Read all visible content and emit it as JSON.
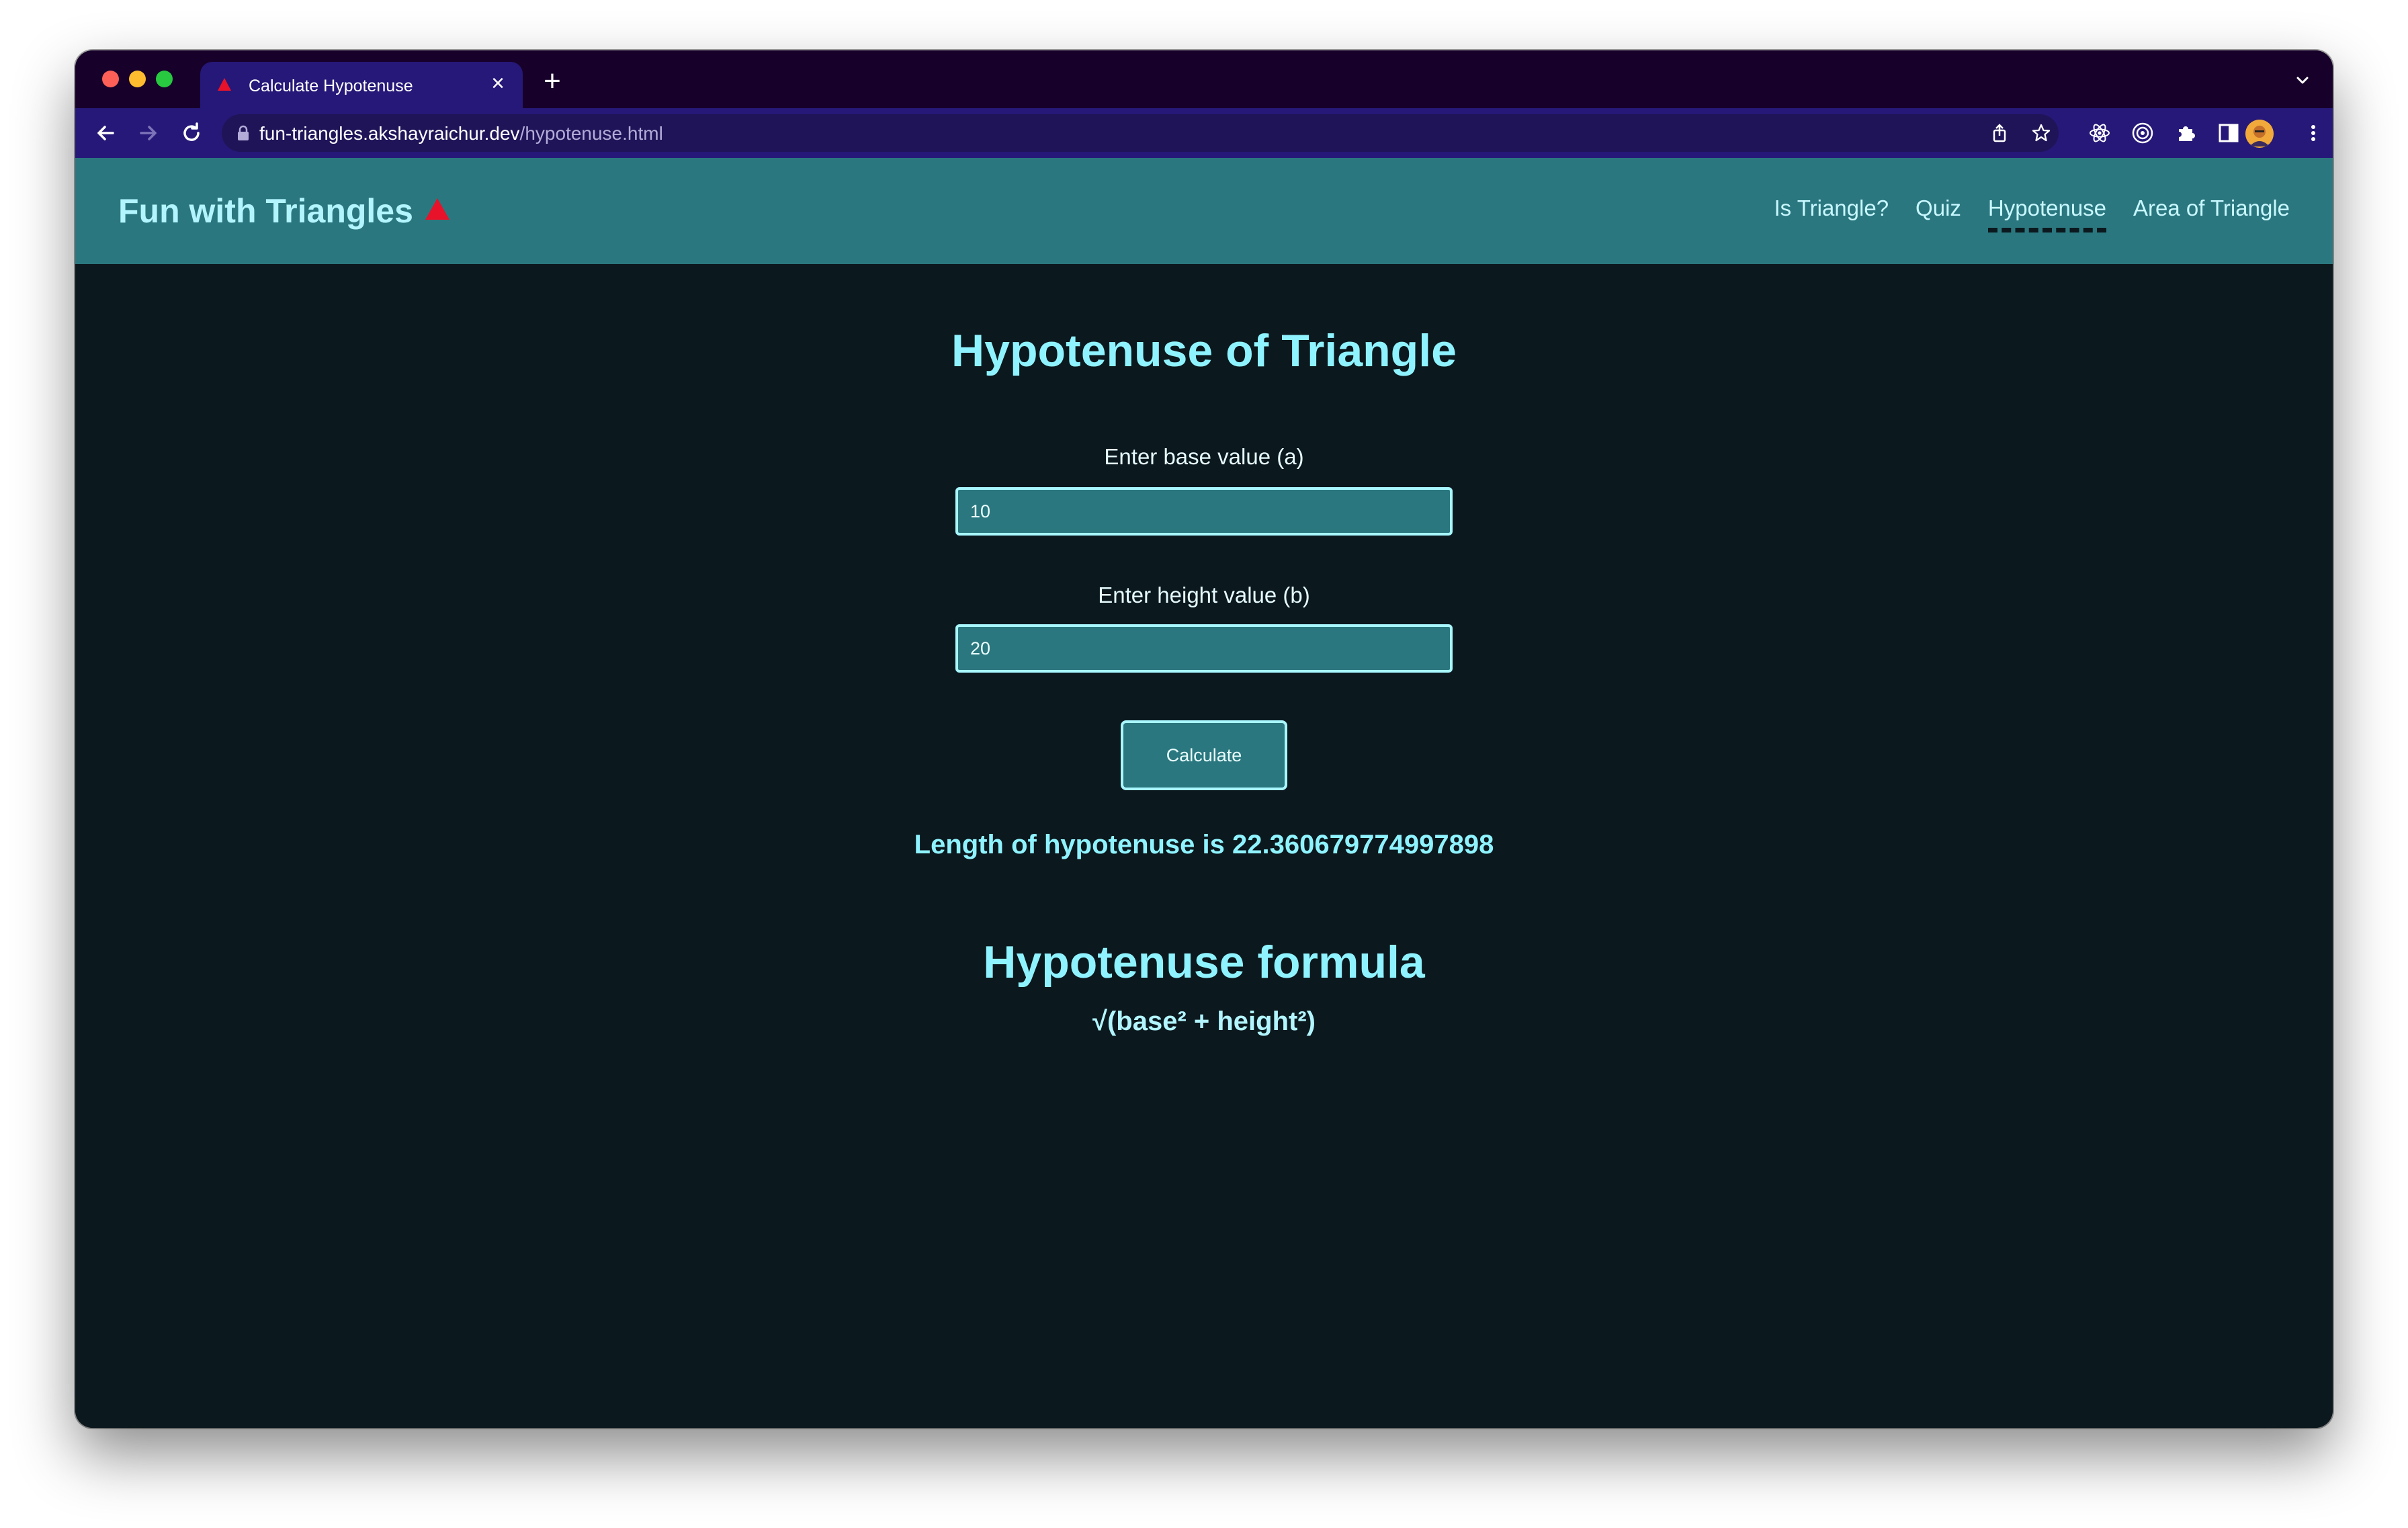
{
  "browser": {
    "tab_title": "Calculate Hypotenuse",
    "tab_close": "×",
    "new_tab": "+",
    "url_domain": "fun-triangles.akshayraichur.dev",
    "url_path": "/hypotenuse.html",
    "icons": [
      "back-arrow-icon",
      "forward-arrow-icon",
      "reload-icon",
      "lock-icon",
      "share-icon",
      "bookmark-star-icon",
      "react-devtools-icon",
      "extension-target-icon",
      "extensions-puzzle-icon",
      "side-panel-icon",
      "profile-avatar",
      "more-menu-icon",
      "tab-search-chevron-icon"
    ]
  },
  "site": {
    "brand": "Fun with Triangles",
    "nav": [
      {
        "label": "Is Triangle?"
      },
      {
        "label": "Quiz"
      },
      {
        "label": "Hypotenuse",
        "active": true
      },
      {
        "label": "Area of Triangle"
      }
    ]
  },
  "main": {
    "title": "Hypotenuse of Triangle",
    "base_label": "Enter base value (a)",
    "base_value": "10",
    "height_label": "Enter height value (b)",
    "height_value": "20",
    "calculate_label": "Calculate",
    "result": "Length of hypotenuse is 22.360679774997898",
    "formula_title": "Hypotenuse formula",
    "formula": "√(base² + height²)"
  },
  "colors": {
    "header_bg": "#2b777f",
    "page_bg": "#0b181d",
    "accent_text": "#8ff3ff",
    "logo_red": "#e8132a",
    "browser_tabstrip": "#17002a",
    "browser_toolbar": "#261878"
  }
}
